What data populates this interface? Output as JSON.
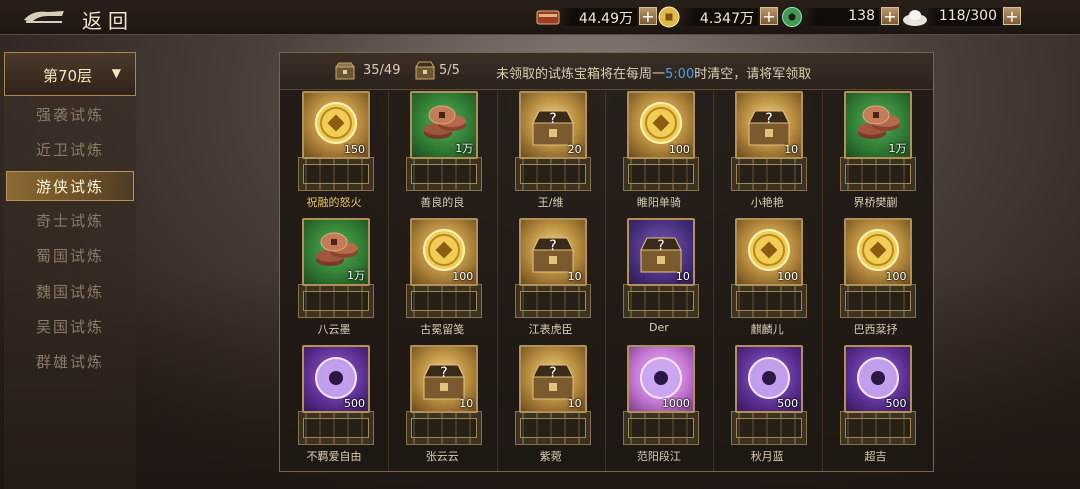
{
  "topbar": {
    "back_label": "返回",
    "resources": [
      {
        "icon": "treasure-icon",
        "value": "44.49万"
      },
      {
        "icon": "gold-coin-icon",
        "value": "4.347万"
      },
      {
        "icon": "jade-icon",
        "value": "138"
      },
      {
        "icon": "silver-ingot-icon",
        "value": "118/300"
      }
    ],
    "plus_label": "+"
  },
  "sidebar": {
    "floor_label": "第70层",
    "caret": "▼",
    "items": [
      {
        "label": "强袭试炼",
        "active": false
      },
      {
        "label": "近卫试炼",
        "active": false
      },
      {
        "label": "游侠试炼",
        "active": true
      },
      {
        "label": "奇士试炼",
        "active": false
      },
      {
        "label": "蜀国试炼",
        "active": false
      },
      {
        "label": "魏国试炼",
        "active": false
      },
      {
        "label": "吴国试炼",
        "active": false
      },
      {
        "label": "群雄试炼",
        "active": false
      }
    ]
  },
  "panel": {
    "chest_count_1": "35/49",
    "chest_count_2": "5/5",
    "notice_before": "未领取的试炼宝箱将在每周一",
    "notice_time": "5:00",
    "notice_after": "时清空，请将军领取",
    "rewards": [
      {
        "type": "gold-coin",
        "frame": "gold",
        "count": "150",
        "name": "祝融的怒火",
        "name_color": "gold"
      },
      {
        "type": "copper-coins",
        "frame": "green",
        "count": "1万",
        "name": "善良的良",
        "name_color": "normal"
      },
      {
        "type": "treasure-chest",
        "frame": "gold",
        "count": "20",
        "name": "王/维",
        "name_color": "normal"
      },
      {
        "type": "gold-coin",
        "frame": "gold",
        "count": "100",
        "name": "睢阳单骑",
        "name_color": "normal"
      },
      {
        "type": "treasure-chest",
        "frame": "gold",
        "count": "10",
        "name": "小艳艳",
        "name_color": "normal"
      },
      {
        "type": "copper-coins",
        "frame": "green",
        "count": "1万",
        "name": "界桥樊蒯",
        "name_color": "normal"
      },
      {
        "type": "copper-coins",
        "frame": "green",
        "count": "1万",
        "name": "八云墨",
        "name_color": "normal"
      },
      {
        "type": "gold-coin",
        "frame": "gold",
        "count": "100",
        "name": "古冕留笺",
        "name_color": "normal"
      },
      {
        "type": "treasure-chest",
        "frame": "gold",
        "count": "10",
        "name": "江表虎臣",
        "name_color": "normal"
      },
      {
        "type": "treasure-chest",
        "frame": "violet",
        "count": "10",
        "name": "Der",
        "name_color": "normal"
      },
      {
        "type": "gold-coin",
        "frame": "gold",
        "count": "100",
        "name": "麒麟儿",
        "name_color": "normal"
      },
      {
        "type": "gold-coin",
        "frame": "gold",
        "count": "100",
        "name": "巴西棻抒",
        "name_color": "normal"
      },
      {
        "type": "jade-ring",
        "frame": "purple",
        "count": "500",
        "name": "不羁爱自由",
        "name_color": "normal"
      },
      {
        "type": "treasure-chest",
        "frame": "gold",
        "count": "10",
        "name": "张云云",
        "name_color": "normal"
      },
      {
        "type": "treasure-chest",
        "frame": "gold",
        "count": "10",
        "name": "紫菀",
        "name_color": "normal"
      },
      {
        "type": "jade-ring",
        "frame": "pink",
        "count": "1000",
        "name": "范阳段江",
        "name_color": "normal"
      },
      {
        "type": "jade-ring",
        "frame": "purple",
        "count": "500",
        "name": "秋月蓝",
        "name_color": "normal"
      },
      {
        "type": "jade-ring",
        "frame": "purple",
        "count": "500",
        "name": "超吉",
        "name_color": "normal"
      }
    ]
  }
}
